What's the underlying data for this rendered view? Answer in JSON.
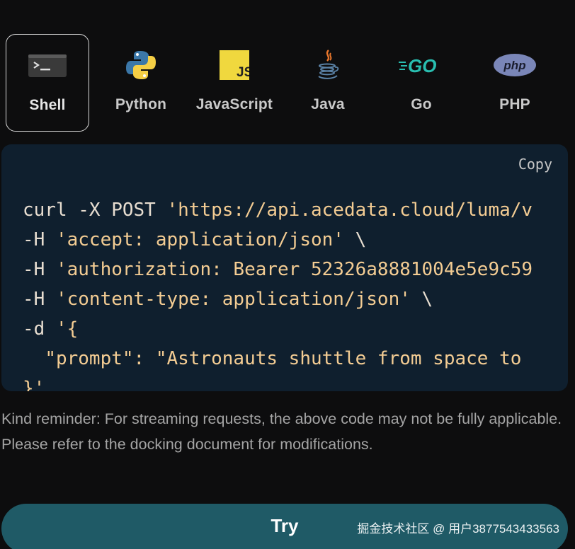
{
  "languages": [
    {
      "label": "Shell",
      "icon": "terminal-icon",
      "active": true
    },
    {
      "label": "Python",
      "icon": "python-icon",
      "active": false
    },
    {
      "label": "JavaScript",
      "icon": "javascript-icon",
      "active": false
    },
    {
      "label": "Java",
      "icon": "java-icon",
      "active": false
    },
    {
      "label": "Go",
      "icon": "go-icon",
      "active": false
    },
    {
      "label": "PHP",
      "icon": "php-icon",
      "active": false
    }
  ],
  "code": {
    "copy_label": "Copy",
    "lines": [
      {
        "plain": "curl -X POST ",
        "str": "'https://api.acedata.cloud/luma/v"
      },
      {
        "plain": "-H ",
        "str": "'accept: application/json'",
        "tail": " \\"
      },
      {
        "plain": "-H ",
        "str": "'authorization: Bearer 52326a8881004e5e9c59"
      },
      {
        "plain": "-H ",
        "str": "'content-type: application/json'",
        "tail": " \\"
      },
      {
        "plain": "-d ",
        "str": "'{"
      },
      {
        "plain": "  ",
        "str": "\"prompt\": \"Astronauts shuttle from space to"
      },
      {
        "plain": "",
        "str": "}'"
      }
    ]
  },
  "reminder": "Kind reminder: For streaming requests, the above code may not be fully applicable. Please refer to the docking document for modifications.",
  "try_label": "Try",
  "watermark": "掘金技术社区 @ 用户3877543433563",
  "colors": {
    "background": "#0d0d0e",
    "code_bg": "#0f1f2e",
    "try_bg": "#1f5a66",
    "string": "#f3cc93"
  }
}
